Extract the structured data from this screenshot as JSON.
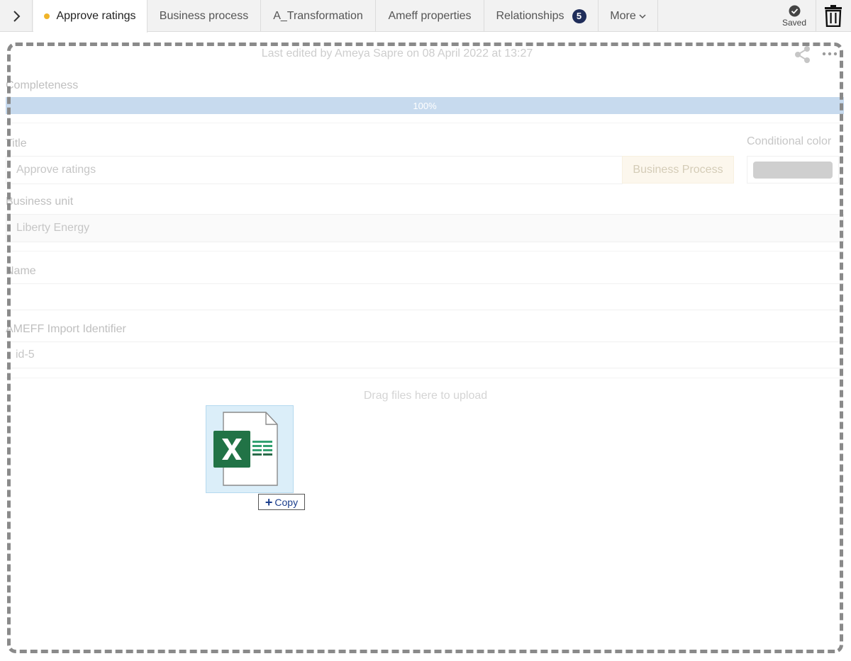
{
  "tabs": {
    "active": "Approve ratings",
    "items": [
      "Business process",
      "A_Transformation",
      "Ameff properties",
      "Relationships",
      "More"
    ],
    "relationships_count": "5"
  },
  "toolbar": {
    "saved_label": "Saved",
    "icons": [
      "chevron-right-icon",
      "check-circle-icon",
      "trash-icon"
    ]
  },
  "header": {
    "last_edited": "Last edited by Ameya Sapre on 08 April 2022 at 13:27",
    "icons": [
      "share-icon",
      "more-dots-icon"
    ]
  },
  "form": {
    "completeness_label": "Completeness",
    "completeness_value": "100%",
    "title_label": "Title",
    "title_value": "Approve ratings",
    "type_chip": "Business Process",
    "conditional_color_label": "Conditional color",
    "conditional_color": "#8c8c8c",
    "business_unit_label": "Business unit",
    "business_unit_value": "Liberty Energy",
    "name_label": "Name",
    "name_value": "",
    "ameff_label": "AMEFF Import Identifier",
    "ameff_value": "id-5"
  },
  "upload": {
    "drag_text": "Drag files here to upload",
    "file_icon": "excel-file-icon",
    "copy_label": "Copy"
  },
  "colors": {
    "active_dot": "#f0b429",
    "badge": "#1f2d5a",
    "progress": "#7aa8d6",
    "excel_green": "#217346"
  }
}
